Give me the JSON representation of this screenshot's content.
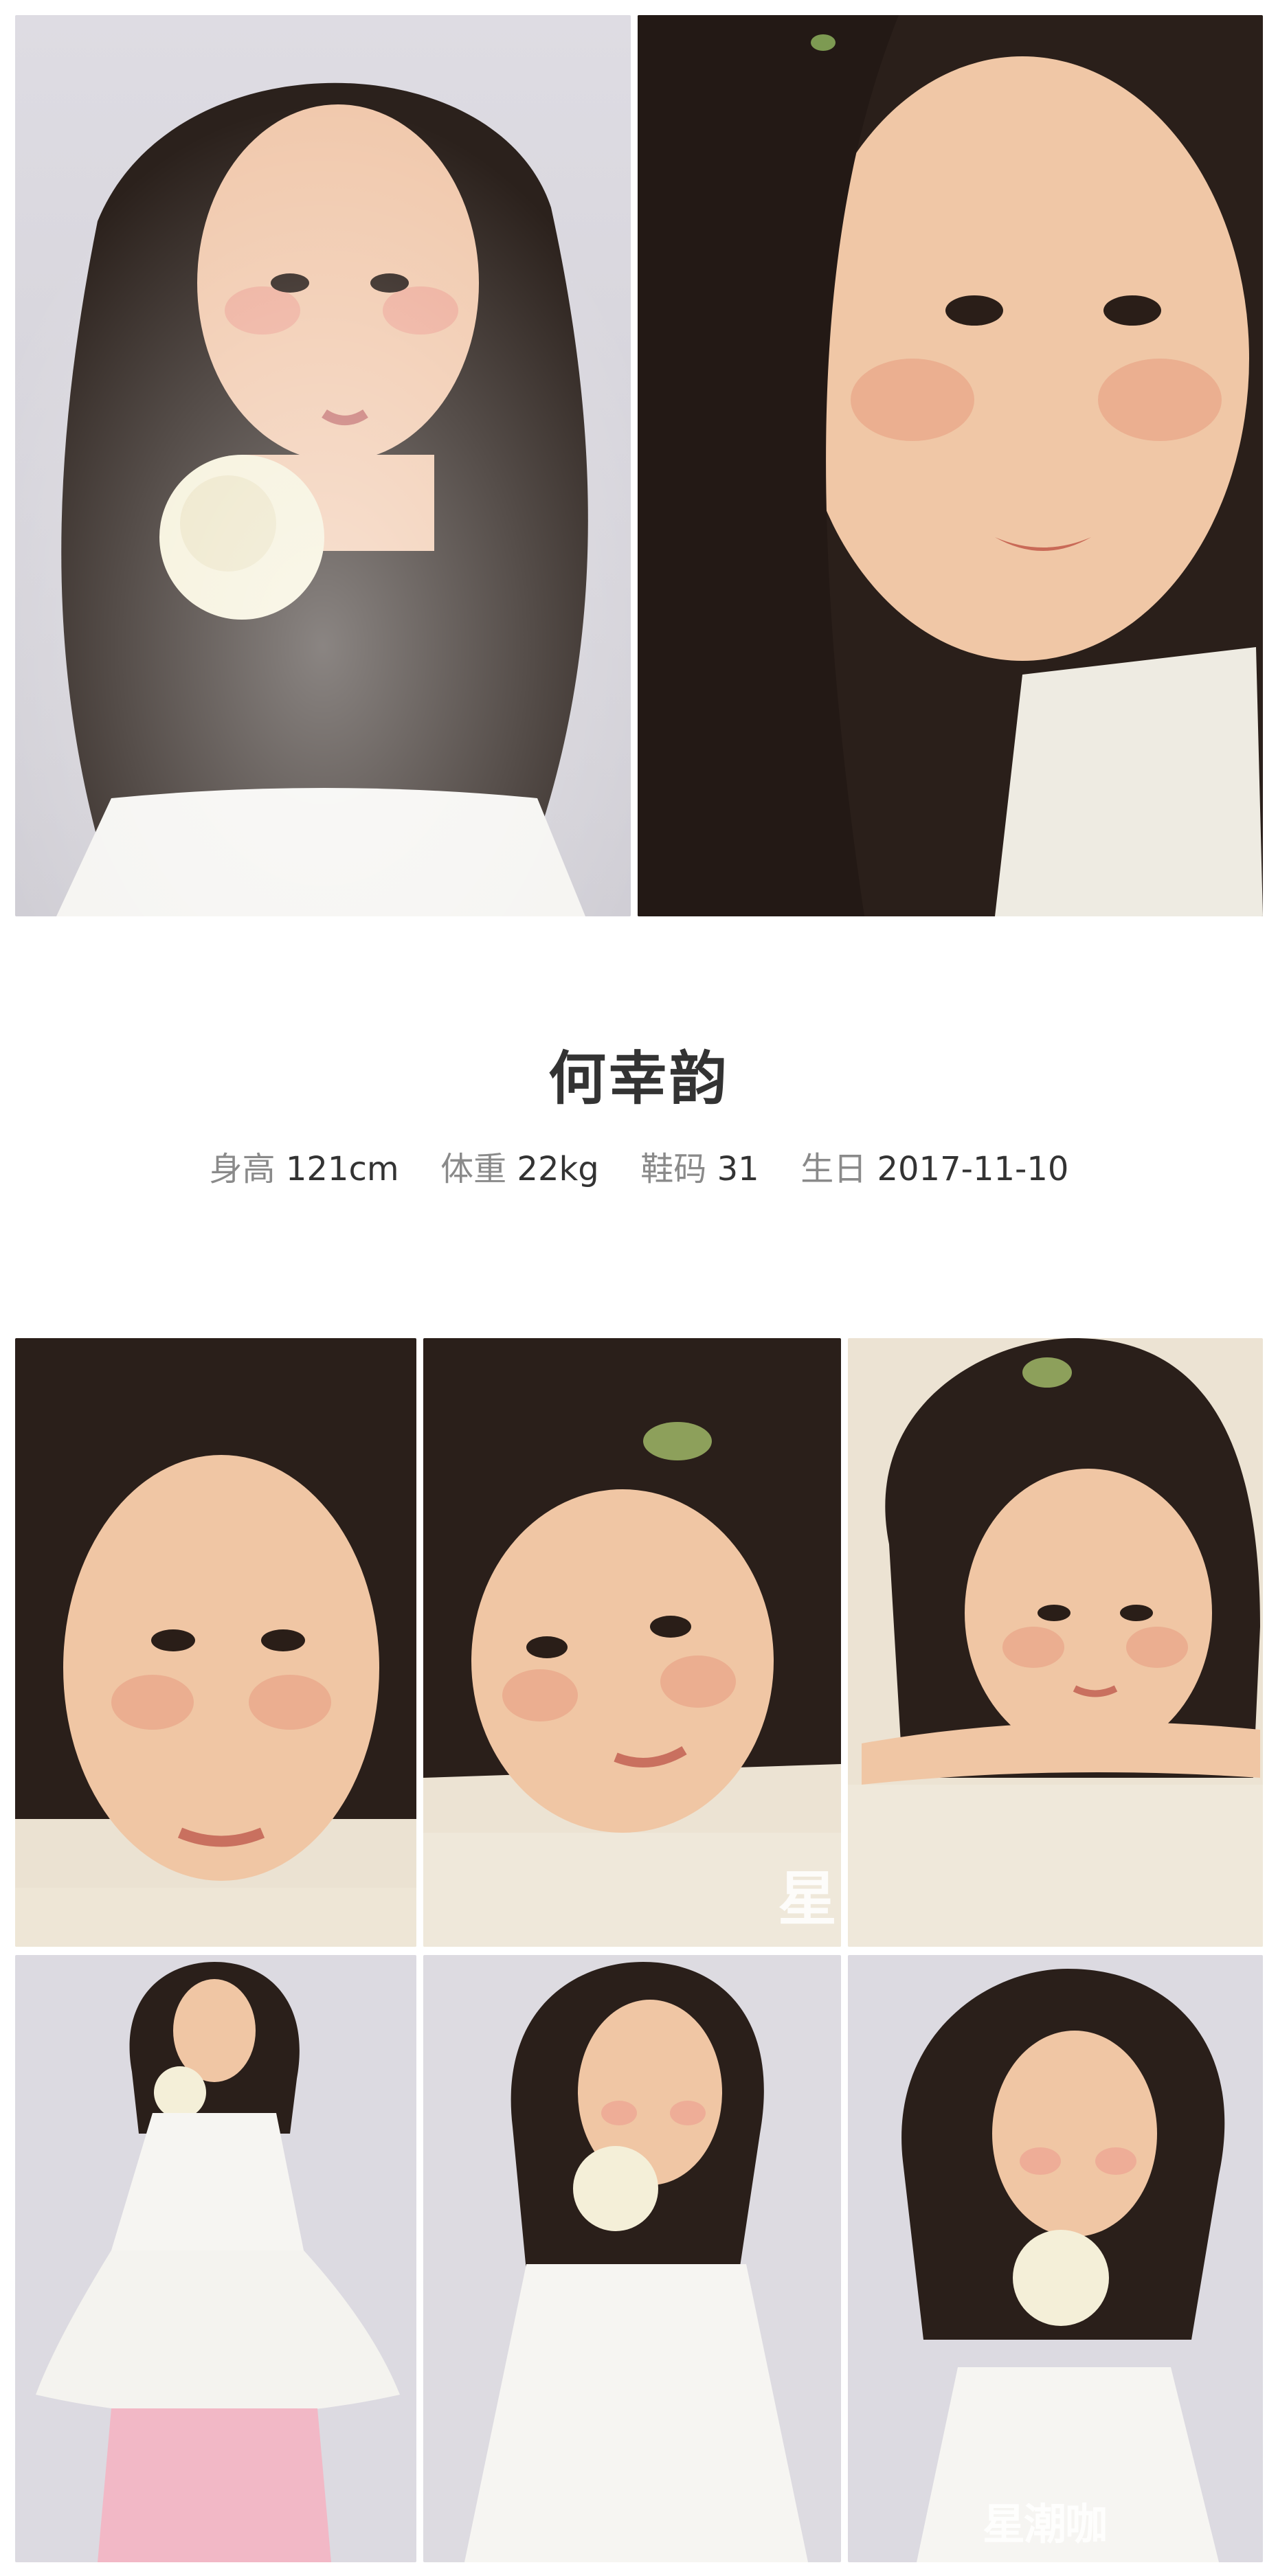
{
  "profile": {
    "name": "何幸韵",
    "height_label": "身高",
    "height_value": "121cm",
    "weight_label": "体重",
    "weight_value": "22kg",
    "shoe_label": "鞋码",
    "shoe_value": "31",
    "birthday_label": "生日",
    "birthday_value": "2017-11-10"
  },
  "watermarks": {
    "middle": "星",
    "bottom": "星潮咖"
  },
  "colors": {
    "background": "#ffffff",
    "text_dark": "#333333",
    "text_label": "#8a8a8a",
    "studio_grey": "#d8d6dc",
    "studio_warm": "#e8dfcf",
    "hair": "#2a1f1a",
    "skin": "#f0c7a8",
    "dress_white": "#f6f5f2",
    "flower_cream": "#f4efd8",
    "tulle_pink": "#f2b8c6"
  }
}
